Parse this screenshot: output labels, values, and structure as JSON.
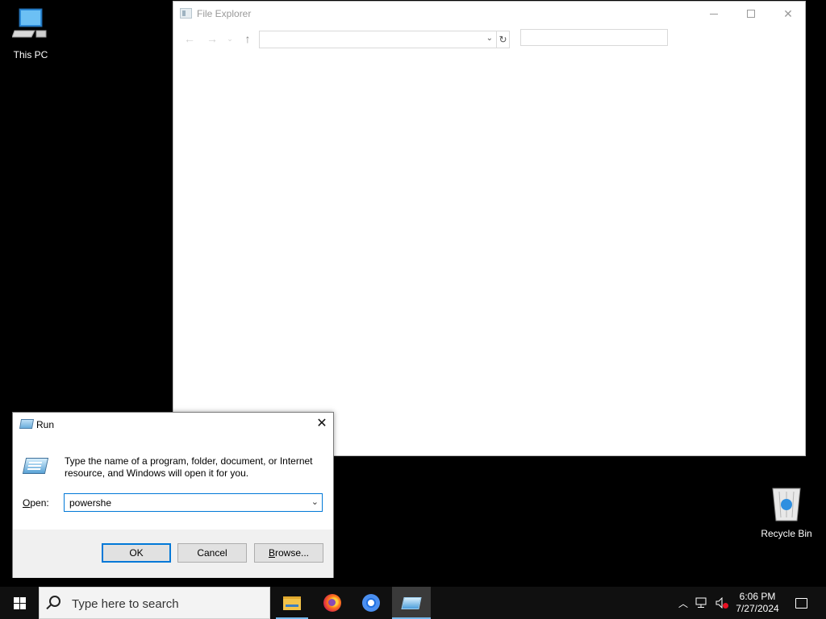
{
  "desktop": {
    "icons": [
      {
        "name": "this-pc",
        "label": "This PC"
      },
      {
        "name": "recycle-bin",
        "label": "Recycle Bin"
      }
    ]
  },
  "explorer": {
    "title": "File Explorer",
    "address_value": "",
    "search_value": "",
    "controls": {
      "minimize": "minimize",
      "maximize": "maximize",
      "close": "close"
    }
  },
  "run_dialog": {
    "title": "Run",
    "description": "Type the name of a program, folder, document, or Internet resource, and Windows will open it for you.",
    "open_label_accel": "O",
    "open_label_rest": "pen:",
    "input_value": "powershe",
    "buttons": {
      "ok": "OK",
      "cancel": "Cancel",
      "browse_accel": "B",
      "browse_rest": "rowse..."
    }
  },
  "taskbar": {
    "search_placeholder": "Type here to search",
    "apps": [
      "file-explorer",
      "firefox",
      "chrome",
      "run"
    ],
    "clock": {
      "time": "6:06 PM",
      "date": "7/27/2024"
    },
    "accent_color": "#76b9ed"
  }
}
